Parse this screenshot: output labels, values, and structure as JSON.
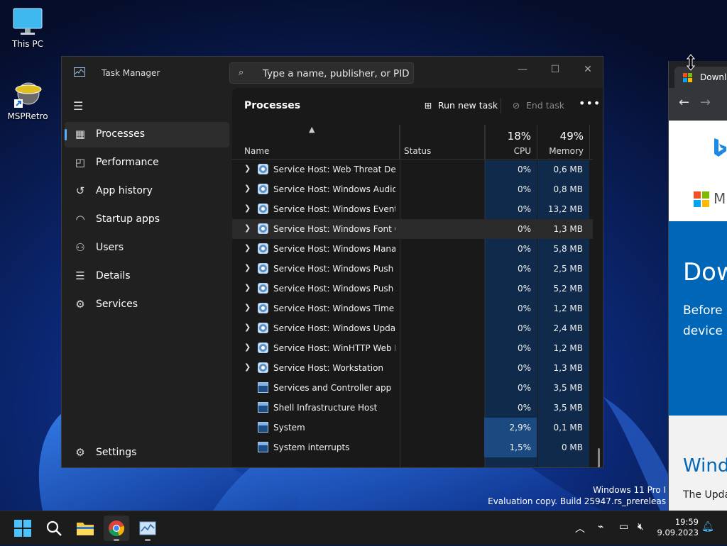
{
  "desktop": {
    "icons": [
      {
        "label": "This PC"
      },
      {
        "label": "MSPRetro"
      }
    ],
    "watermark": {
      "line1": "Windows 11 Pro I",
      "line2": "Evaluation copy. Build 25947.rs_prereleas"
    }
  },
  "task_manager": {
    "title": "Task Manager",
    "search_placeholder": "Type a name, publisher, or PID...",
    "window_controls": {
      "minimize": "—",
      "maximize": "☐",
      "close": "✕"
    },
    "nav": {
      "items": [
        {
          "label": "Processes",
          "icon": "processes-icon",
          "active": true
        },
        {
          "label": "Performance",
          "icon": "performance-icon"
        },
        {
          "label": "App history",
          "icon": "app-history-icon"
        },
        {
          "label": "Startup apps",
          "icon": "startup-apps-icon"
        },
        {
          "label": "Users",
          "icon": "users-icon"
        },
        {
          "label": "Details",
          "icon": "details-icon"
        },
        {
          "label": "Services",
          "icon": "services-icon"
        }
      ],
      "settings_label": "Settings"
    },
    "toolbar": {
      "page_title": "Processes",
      "run_new_task": "Run new task",
      "end_task": "End task"
    },
    "columns": {
      "name": "Name",
      "status": "Status",
      "cpu_label": "CPU",
      "cpu_total": "18%",
      "memory_label": "Memory",
      "memory_total": "49%"
    },
    "rows": [
      {
        "name": "Service Host: Web Threat Defe...",
        "cpu": "0%",
        "memory": "0,6 MB",
        "expandable": true,
        "icon": "gear"
      },
      {
        "name": "Service Host: Windows Audio ...",
        "cpu": "0%",
        "memory": "0,8 MB",
        "expandable": true,
        "icon": "gear"
      },
      {
        "name": "Service Host: Windows Event ...",
        "cpu": "0%",
        "memory": "13,2 MB",
        "expandable": true,
        "icon": "gear"
      },
      {
        "name": "Service Host: Windows Font C...",
        "cpu": "0%",
        "memory": "1,3 MB",
        "expandable": true,
        "icon": "gear",
        "hover": true
      },
      {
        "name": "Service Host: Windows Manag...",
        "cpu": "0%",
        "memory": "5,8 MB",
        "expandable": true,
        "icon": "gear"
      },
      {
        "name": "Service Host: Windows Push ...",
        "cpu": "0%",
        "memory": "2,5 MB",
        "expandable": true,
        "icon": "gear"
      },
      {
        "name": "Service Host: Windows Push ...",
        "cpu": "0%",
        "memory": "5,2 MB",
        "expandable": true,
        "icon": "gear"
      },
      {
        "name": "Service Host: Windows Time",
        "cpu": "0%",
        "memory": "1,2 MB",
        "expandable": true,
        "icon": "gear"
      },
      {
        "name": "Service Host: Windows Update",
        "cpu": "0%",
        "memory": "2,4 MB",
        "expandable": true,
        "icon": "gear"
      },
      {
        "name": "Service Host: WinHTTP Web P...",
        "cpu": "0%",
        "memory": "1,2 MB",
        "expandable": true,
        "icon": "gear"
      },
      {
        "name": "Service Host: Workstation",
        "cpu": "0%",
        "memory": "1,3 MB",
        "expandable": true,
        "icon": "gear"
      },
      {
        "name": "Services and Controller app",
        "cpu": "0%",
        "memory": "3,5 MB",
        "expandable": false,
        "icon": "win"
      },
      {
        "name": "Shell Infrastructure Host",
        "cpu": "0%",
        "memory": "3,5 MB",
        "expandable": false,
        "icon": "win"
      },
      {
        "name": "System",
        "cpu": "2,9%",
        "memory": "0,1 MB",
        "expandable": false,
        "icon": "win",
        "cpu_hot": true
      },
      {
        "name": "System interrupts",
        "cpu": "1,5%",
        "memory": "0 MB",
        "expandable": false,
        "icon": "win",
        "cpu_hot": true
      }
    ]
  },
  "browser": {
    "tab_title": "Downlo",
    "page": {
      "brand": "Mi",
      "heading": "Dow",
      "text_line1": "Before u",
      "text_line2": "device i",
      "section_heading": "Windo",
      "section_text": "The Upda"
    }
  },
  "taskbar": {
    "clock_time": "19:59",
    "clock_date": "9.09.2023"
  },
  "colors": {
    "accent": "#5ab0ff",
    "window_bg": "#202020",
    "heat_cell": "#0f2a4a",
    "ms_blue": "#0067b8"
  }
}
